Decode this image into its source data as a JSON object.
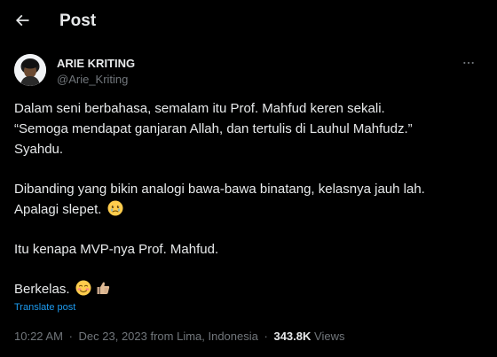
{
  "header": {
    "back_icon": "arrow-left-icon",
    "title": "Post"
  },
  "author": {
    "avatar_icon": "profile-avatar",
    "name": "ARIE KRITING",
    "handle": "@Arie_Kriting",
    "more_icon": "more-horizontal-icon"
  },
  "tweet": {
    "paragraphs": [
      {
        "lines": [
          "Dalam seni berbahasa, semalam itu Prof. Mahfud keren sekali.",
          "“Semoga mendapat ganjaran Allah, dan tertulis di Lauhul Mahfudz.”",
          "Syahdu."
        ]
      },
      {
        "line1": "Dibanding yang bikin analogi bawa-bawa binatang, kelasnya jauh lah.",
        "line2": "Apalagi slepet.",
        "emoji": "face-holding-back-tears-icon"
      },
      {
        "text": "Itu kenapa MVP-nya Prof. Mahfud."
      },
      {
        "text": "Berkelas.",
        "emojis": [
          "smiling-face-icon",
          "thumbs-up-icon"
        ]
      }
    ],
    "translate_label": "Translate post"
  },
  "meta": {
    "time": "10:22 AM",
    "separator1": "·",
    "date": "Dec 23, 2023 from Lima, Indonesia",
    "separator2": "·",
    "views_count": "343.8K",
    "views_label": "Views"
  },
  "colors": {
    "background": "#000000",
    "text_primary": "#e7e9ea",
    "text_secondary": "#71767b",
    "link": "#1d9bf0"
  }
}
